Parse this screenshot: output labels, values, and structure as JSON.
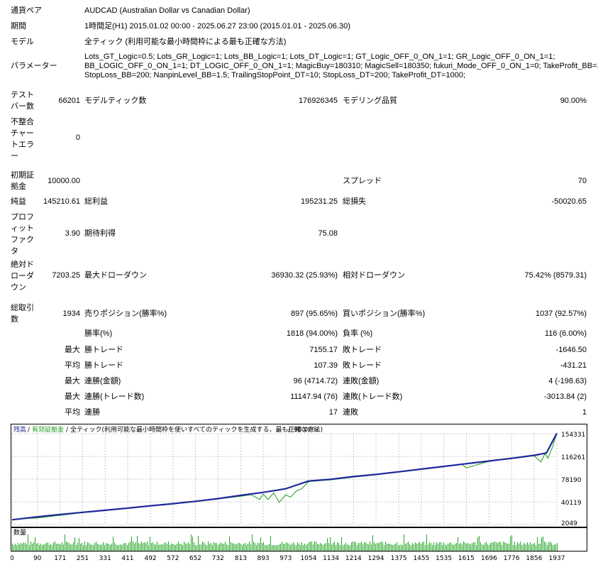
{
  "report": {
    "symbol_label": "通貨ペア",
    "symbol_value": "AUDCAD (Australian Dollar vs Canadian Dollar)",
    "period_label": "期間",
    "period_value": "1時間足(H1) 2015.01.02 00:00 - 2025.06.27 23:00 (2015.01.01 - 2025.06.30)",
    "model_label": "モデル",
    "model_value": "全ティック (利用可能な最小時間枠による最も正確な方法)",
    "params_label": "パラメーター",
    "params_lines": [
      "Lots_GT_Logic=0.5; Lots_GR_Logic=1; Lots_BB_Logic=1; Lots_DT_Logic=1; GT_Logic_OFF_0_ON_1=1; GR_Logic_OFF_0_ON_1=1;",
      "BB_LOGIC_OFF_0_ON_1=1; DT_LOGIC_OFF_0_ON_1=1; MagicBuy=180310; MagicSell=180350; fukuri_Mode_OFF_0_ON_1=0; TakeProfit_BB=10;",
      "StopLoss_BB=200; NanpinLevel_BB=1.5; TrailingStopPoint_DT=10; StopLoss_DT=200; TakeProfit_DT=1000;"
    ],
    "bars_label": "テスト\nバー数",
    "bars_value": "66201",
    "ticks_label": "モデルティック数",
    "ticks_value": "176926345",
    "quality_label": "モデリング品質",
    "quality_value": "90.00%",
    "mismatch_label": "不整合\nチャー\nトエラ\nー",
    "mismatch_value": "0",
    "deposit_label": "初期証\n拠金",
    "deposit_value": "10000.00",
    "spread_label": "スプレッド",
    "spread_value": "70",
    "net_label": "純益",
    "net_value": "145210.61",
    "gross_profit_label": "総利益",
    "gross_profit_value": "195231.25",
    "gross_loss_label": "総損失",
    "gross_loss_value": "-50020.65",
    "pf_label": "プロフ\nィット\nファク\nタ",
    "pf_value": "3.90",
    "expected_label": "期待利得",
    "expected_value": "75.08",
    "abs_dd_label": "絶対ド\nローダ\nウン",
    "abs_dd_value": "7203.25",
    "max_dd_label": "最大ドローダウン",
    "max_dd_value": "36930.32 (25.93%)",
    "rel_dd_label": "相対ドローダウン",
    "rel_dd_value": "75.42% (8579.31)",
    "total_trades_label": "総取引\n数",
    "total_trades_value": "1934",
    "short_label": "売りポジション(勝率%)",
    "short_value": "897 (95.65%)",
    "long_label": "買いポジション(勝率%)",
    "long_value": "1037 (92.57%)",
    "win_label": "勝率(%)",
    "win_value": "1818 (94.00%)",
    "loss_label": "負率 (%)",
    "loss_value": "116 (6.00%)",
    "max1_label": "最大",
    "largest_win_label": "勝トレード",
    "largest_win_value": "7155.17",
    "largest_loss_label": "敗トレード",
    "largest_loss_value": "-1646.50",
    "avg1_label": "平均",
    "avg_win_label": "勝トレード",
    "avg_win_value": "107.39",
    "avg_loss_label": "敗トレード",
    "avg_loss_value": "-431.21",
    "max2_label": "最大",
    "cons_wins_label": "連勝(金額)",
    "cons_wins_value": "96 (4714.72)",
    "cons_losses_label": "連敗(金額)",
    "cons_losses_value": "4 (-198.63)",
    "max3_label": "最大",
    "cons_profit_label": "連勝(トレード数)",
    "cons_profit_value": "11147.94 (76)",
    "cons_loss_label": "連敗(トレード数)",
    "cons_loss_value": "-3013.84 (2)",
    "avg2_label": "平均",
    "avg_cons_wins_label": "連勝",
    "avg_cons_wins_value": "17",
    "avg_cons_losses_label": "連敗",
    "avg_cons_losses_value": "1"
  },
  "chart_header": {
    "balance": "残高",
    "sep1": "/",
    "equity": "有効証拠金",
    "sep2": "/",
    "model": "全ティック(利用可能な最小時間枠を使いすべてのティックを生成する、最も正確な方法)",
    "sep3": "/",
    "quality": "90.00%"
  },
  "volume_label": "数量",
  "colors": {
    "balance": "#1f2a9a",
    "equity": "#1a9a1a",
    "volume": "#22a522",
    "grid": "#c8c8c8"
  },
  "chart_data": {
    "type": "line",
    "title": "",
    "xlabel": "",
    "ylabel": "",
    "x_ticks": [
      "0",
      "90",
      "171",
      "251",
      "331",
      "411",
      "492",
      "572",
      "652",
      "732",
      "813",
      "893",
      "973",
      "1054",
      "1134",
      "1214",
      "1294",
      "1375",
      "1455",
      "1535",
      "1615",
      "1696",
      "1776",
      "1856",
      "1937"
    ],
    "y_ticks": [
      "154331",
      "116261",
      "78190",
      "40119",
      "2049"
    ],
    "xlim": [
      0,
      1937
    ],
    "ylim": [
      2049,
      154331
    ],
    "grid": true,
    "series": [
      {
        "name": "残高",
        "x": [
          0,
          90,
          171,
          251,
          331,
          411,
          492,
          572,
          652,
          732,
          813,
          893,
          973,
          1054,
          1134,
          1214,
          1294,
          1375,
          1455,
          1535,
          1615,
          1696,
          1776,
          1856,
          1900,
          1937
        ],
        "values": [
          10000,
          15000,
          19000,
          22500,
          26000,
          29500,
          33500,
          37000,
          41000,
          45500,
          51000,
          56000,
          62000,
          75000,
          78000,
          82500,
          86000,
          90500,
          95000,
          99500,
          104000,
          108500,
          113000,
          118000,
          122000,
          155210
        ]
      },
      {
        "name": "有効証拠金",
        "x": [
          0,
          60,
          90,
          150,
          171,
          251,
          331,
          411,
          492,
          572,
          652,
          732,
          813,
          850,
          880,
          893,
          910,
          930,
          950,
          973,
          990,
          1010,
          1030,
          1054,
          1134,
          1214,
          1294,
          1375,
          1455,
          1535,
          1600,
          1615,
          1696,
          1776,
          1856,
          1880,
          1895,
          1905,
          1920,
          1937
        ],
        "values": [
          10000,
          12500,
          13000,
          16500,
          17500,
          22000,
          25500,
          29000,
          33000,
          36500,
          40500,
          45000,
          49500,
          52000,
          44000,
          53000,
          44000,
          55000,
          39000,
          52000,
          48000,
          58000,
          62000,
          74000,
          77000,
          81500,
          85500,
          90000,
          94500,
          99000,
          103000,
          97000,
          108000,
          112500,
          117500,
          107000,
          121000,
          113000,
          130000,
          155000
        ]
      }
    ],
    "volume_label": "数量"
  }
}
